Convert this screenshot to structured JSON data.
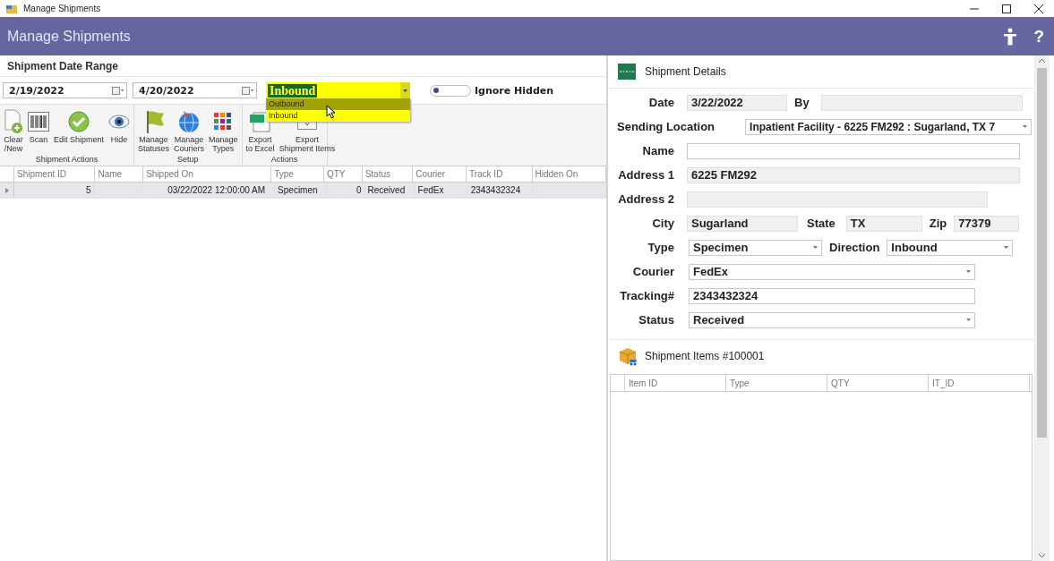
{
  "window": {
    "title": "Manage Shipments"
  },
  "header": {
    "title": "Manage Shipments",
    "help": "?"
  },
  "filters": {
    "label": "Shipment Date Range",
    "start_date": "2/19/2022",
    "end_date": "4/20/2022",
    "direction": {
      "value": "Inbound",
      "options": [
        {
          "label": "Outbound",
          "highlighted": true
        },
        {
          "label": "Inbound",
          "highlighted": false
        }
      ]
    },
    "ignore_hidden": {
      "label": "Ignore Hidden",
      "on": false
    }
  },
  "ribbon": {
    "groups": [
      {
        "label": "Shipment Actions",
        "buttons": [
          {
            "label": "Clear\n/New"
          },
          {
            "label": "Scan"
          },
          {
            "label": "Edit Shipment"
          },
          {
            "label": "Hide"
          }
        ]
      },
      {
        "label": "Setup",
        "buttons": [
          {
            "label": "Manage\nStatuses"
          },
          {
            "label": "Manage\nCouriers"
          },
          {
            "label": "Manage\nTypes"
          }
        ]
      },
      {
        "label": "Actions",
        "buttons": [
          {
            "label": "Export\nto Excel"
          },
          {
            "label": "Export\nShipment Items"
          }
        ]
      }
    ]
  },
  "grid": {
    "columns": [
      {
        "label": "Shipment ID",
        "kind": "number"
      },
      {
        "label": "Name",
        "kind": "text"
      },
      {
        "label": "Shipped On",
        "kind": "number"
      },
      {
        "label": "Type",
        "kind": "text"
      },
      {
        "label": "QTY",
        "kind": "number"
      },
      {
        "label": "Status",
        "kind": "text"
      },
      {
        "label": "Courier",
        "kind": "text"
      },
      {
        "label": "Track ID",
        "kind": "text"
      },
      {
        "label": "Hidden On",
        "kind": "text"
      }
    ],
    "rows": [
      {
        "selected": true,
        "shipment_id": "5",
        "shipped_on": "03/22/2022 12:00:00 AM",
        "type": "Specimen",
        "qty": "0",
        "status": "Received",
        "courier": "FedEx",
        "track_id": "2343432324"
      }
    ]
  },
  "details": {
    "title": "Shipment Details",
    "lines": [
      [
        {
          "label": "Date",
          "value": "3/22/2022",
          "kind": "readonly"
        },
        {
          "label": "By",
          "kind": "readonly"
        }
      ],
      [
        {
          "label": "Sending Location",
          "value": "Inpatient Facility - 6225 FM292  : Sugarland, TX 7",
          "kind": "combo"
        }
      ],
      [
        {
          "label": "Name",
          "kind": "text"
        }
      ],
      [
        {
          "label": "Address 1",
          "value": "6225 FM292",
          "kind": "readonly"
        }
      ],
      [
        {
          "label": "Address 2",
          "kind": "readonly"
        }
      ],
      [
        {
          "label": "City",
          "value": "Sugarland",
          "kind": "readonly"
        },
        {
          "label": "State",
          "value": "TX",
          "kind": "readonly"
        },
        {
          "label": "Zip",
          "value": "77379",
          "kind": "readonly"
        }
      ],
      [
        {
          "label": "Type",
          "value": "Specimen",
          "kind": "combo"
        },
        {
          "label": "Direction",
          "value": "Inbound",
          "kind": "combo"
        }
      ],
      [
        {
          "label": "Courier",
          "value": "FedEx",
          "kind": "combo"
        }
      ],
      [
        {
          "label": "Tracking#",
          "value": "2343432324",
          "kind": "text"
        }
      ],
      [
        {
          "label": "Status",
          "value": "Received",
          "kind": "combo"
        }
      ]
    ]
  },
  "items": {
    "title": "Shipment Items #100001",
    "columns": [
      "Item ID",
      "Type",
      "QTY",
      "IT_ID"
    ]
  }
}
